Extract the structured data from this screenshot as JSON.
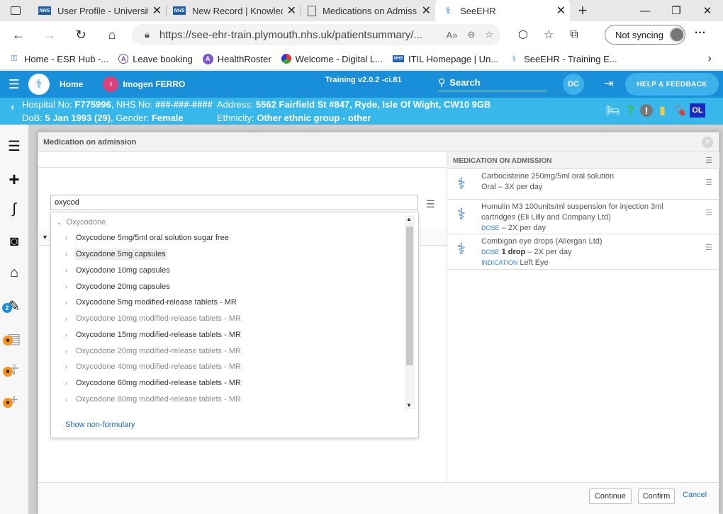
{
  "browser": {
    "tabs": [
      {
        "title": "User Profile - University",
        "icon": "nhs-icon"
      },
      {
        "title": "New Record | Knowledg",
        "icon": "nhs-icon"
      },
      {
        "title": "Medications on Admiss",
        "icon": "document-icon"
      },
      {
        "title": "SeeEHR",
        "icon": "seeehr-icon"
      }
    ],
    "url": "https://see-ehr-train.plymouth.nhs.uk/patientsummary/...",
    "sync_label": "Not syncing",
    "favourites": [
      {
        "label": "Home - ESR Hub -...",
        "icon": "key-icon"
      },
      {
        "label": "Leave booking",
        "icon": "a-circle-icon"
      },
      {
        "label": "HealthRoster",
        "icon": "a-circle-filled-icon"
      },
      {
        "label": "Welcome - Digital L...",
        "icon": "multicolor-icon"
      },
      {
        "label": "ITIL Homepage | Un...",
        "icon": "nhs-icon"
      },
      {
        "label": "SeeEHR - Training E...",
        "icon": "seeehr-icon"
      }
    ]
  },
  "app": {
    "home_label": "Home",
    "patient_name": "Imogen FERRO",
    "training_version": "Training v2.0.2 -ci.81",
    "search_label": "Search",
    "user_initials": "DC",
    "help_label": "HELP & FEEDBACK",
    "ol_badge": "OL"
  },
  "banner": {
    "hospital_no_label": "Hospital No: ",
    "hospital_no": "F775996",
    "nhs_no_label": ", NHS No: ",
    "nhs_no": "###-###-####",
    "address_label": "Address: ",
    "address": "5562 Fairfield St #847, Ryde, Isle Of Wight, CW10 9GB",
    "dob_label": "DoB: ",
    "dob": "5 Jan 1993 (29)",
    "gender_label": ", Gender: ",
    "gender": "Female",
    "ethnicity_label": "Ethnicity: ",
    "ethnicity": "Other ethnic group - other"
  },
  "rail": {
    "badge_count": "2"
  },
  "modal": {
    "title": "Medication on admission",
    "search_value": "oxycod",
    "group_label": "Oxycodone",
    "results": [
      {
        "label": "Oxycodone 5mg/5ml oral solution sugar free",
        "grey": false,
        "highlight": false
      },
      {
        "label": "Oxycodone 5mg capsules",
        "grey": false,
        "highlight": true
      },
      {
        "label": "Oxycodone 10mg capsules",
        "grey": false,
        "highlight": false
      },
      {
        "label": "Oxycodone 20mg capsules",
        "grey": false,
        "highlight": false
      },
      {
        "label": "Oxycodone 5mg modified-release tablets - MR",
        "grey": false,
        "highlight": false
      },
      {
        "label": "Oxycodone 10mg modified-release tablets - MR",
        "grey": true,
        "highlight": false
      },
      {
        "label": "Oxycodone 15mg modified-release tablets - MR",
        "grey": false,
        "highlight": false
      },
      {
        "label": "Oxycodone 20mg modified-release tablets - MR",
        "grey": true,
        "highlight": false
      },
      {
        "label": "Oxycodone 40mg modified-release tablets - MR",
        "grey": true,
        "highlight": false
      },
      {
        "label": "Oxycodone 60mg modified-release tablets - MR",
        "grey": false,
        "highlight": false
      },
      {
        "label": "Oxycodone 80mg modified-release tablets - MR",
        "grey": true,
        "highlight": false
      }
    ],
    "show_non_formulary": "Show non-formulary",
    "right_header": "MEDICATION ON ADMISSION",
    "medications": [
      {
        "name": "Carbocisteine 250mg/5ml oral solution",
        "line2": "Oral – 3X per day"
      },
      {
        "name": "Humulin M3 100units/ml suspension for injection 3ml cartridges (Eli Lilly and Company Ltd)",
        "dose_label": "DOSE",
        "dose_rest": " – 2X per day"
      },
      {
        "name": "Combigan eye drops (Allergan Ltd)",
        "dose_label": "DOSE",
        "dose_value": "1 drop",
        "dose_rest": " – 2X per day",
        "indication_label": "INDICATION",
        "indication": "Left Eye"
      }
    ],
    "buttons": {
      "continue": "Continue",
      "confirm": "Confirm",
      "cancel": "Cancel"
    }
  }
}
